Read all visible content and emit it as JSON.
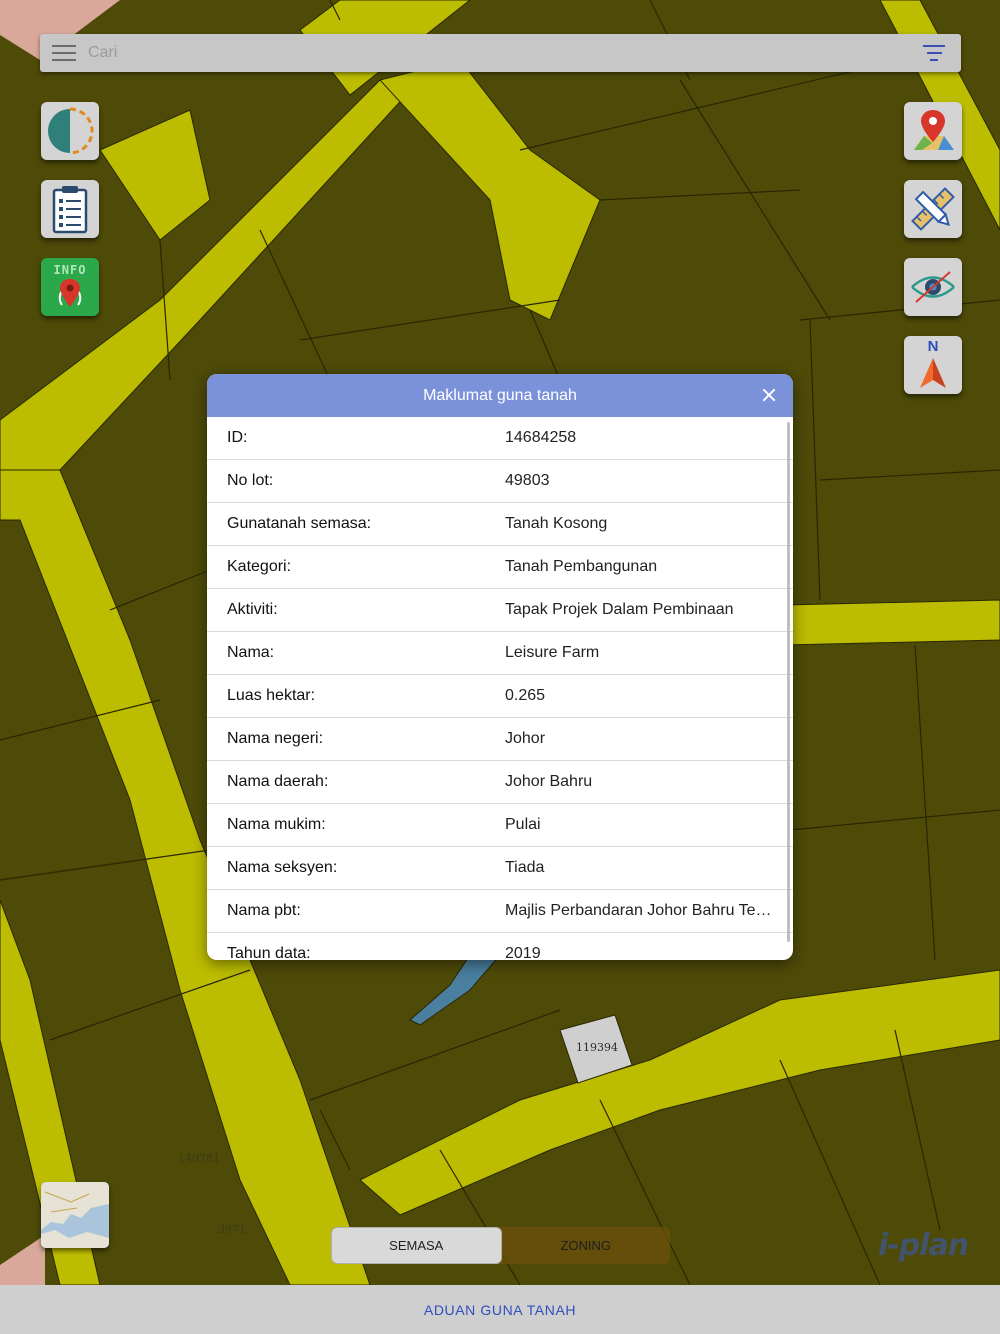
{
  "search": {
    "placeholder": "Cari"
  },
  "dialog": {
    "title": "Maklumat guna tanah",
    "rows": [
      {
        "label": "ID:",
        "value": "14684258"
      },
      {
        "label": "No lot:",
        "value": "49803"
      },
      {
        "label": "Gunatanah semasa:",
        "value": "Tanah Kosong"
      },
      {
        "label": "Kategori:",
        "value": "Tanah Pembangunan"
      },
      {
        "label": "Aktiviti:",
        "value": "Tapak Projek Dalam Pembinaan"
      },
      {
        "label": "Nama:",
        "value": "Leisure Farm"
      },
      {
        "label": "Luas hektar:",
        "value": "0.265"
      },
      {
        "label": "Nama negeri:",
        "value": "Johor"
      },
      {
        "label": "Nama daerah:",
        "value": "Johor Bahru"
      },
      {
        "label": "Nama mukim:",
        "value": "Pulai"
      },
      {
        "label": "Nama seksyen:",
        "value": "Tiada"
      },
      {
        "label": "Nama pbt:",
        "value": "Majlis Perbandaran Johor Bahru Tengah"
      },
      {
        "label": "Tahun data:",
        "value": "2019"
      }
    ]
  },
  "left_tools": [
    {
      "name": "layer-opacity-icon"
    },
    {
      "name": "clipboard-list-icon"
    },
    {
      "name": "info-pin-icon",
      "text": "INFO"
    }
  ],
  "right_tools": [
    {
      "name": "map-pin-icon"
    },
    {
      "name": "pencil-ruler-icon"
    },
    {
      "name": "eye-hidden-icon"
    },
    {
      "name": "north-arrow-icon",
      "text": "N"
    }
  ],
  "map": {
    "lot_labels": [
      "119394",
      "140781",
      "3971"
    ]
  },
  "segment": {
    "options": [
      "SEMASA",
      "ZONING"
    ],
    "selected": "SEMASA"
  },
  "logo": {
    "text": "i-plan"
  },
  "bottom": {
    "label": "ADUAN GUNA TANAH"
  },
  "colors": {
    "land": "#4e4a08",
    "road": "#bcbc00",
    "header": "#7b92db",
    "accent": "#2f4fbf"
  }
}
